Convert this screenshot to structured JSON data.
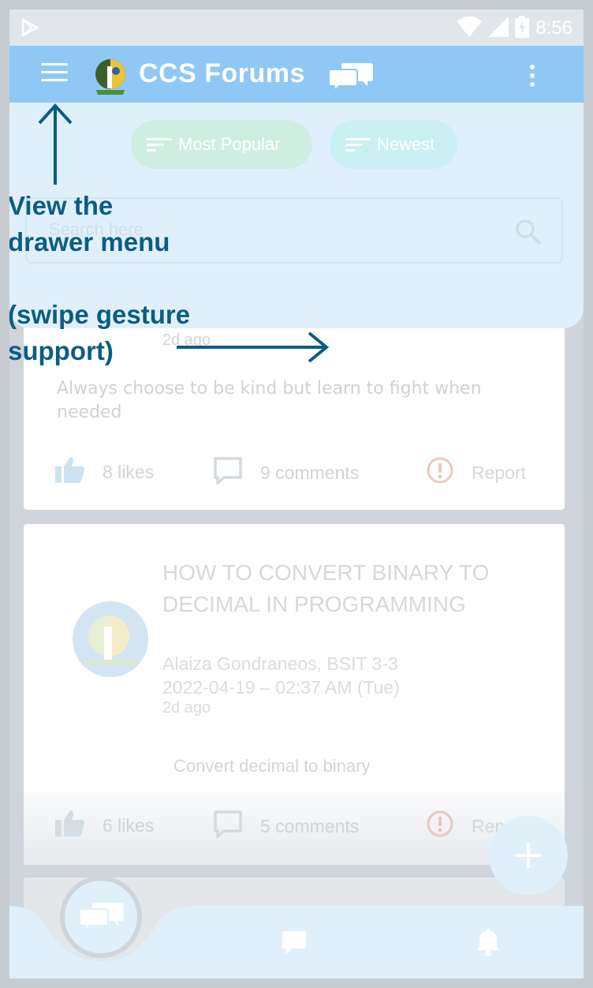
{
  "status_bar": {
    "time": "8:56"
  },
  "app_bar": {
    "title": "CCS Forums"
  },
  "filters": {
    "most_popular": "Most Popular",
    "newest": "Newest"
  },
  "search": {
    "placeholder": "Search here"
  },
  "annotations": {
    "drawer_line1": "View the",
    "drawer_line2": "drawer menu",
    "swipe_line1": "(swipe gesture",
    "swipe_line2": "support)"
  },
  "posts": [
    {
      "ago": "2d ago",
      "body": "Always choose to be kind but learn to fight when needed",
      "likes": "8 likes",
      "comments": "9 comments",
      "report": "Report"
    },
    {
      "title": "HOW TO CONVERT BINARY TO DECIMAL IN PROGRAMMING",
      "author": "Alaiza Gondraneos, BSIT 3-3",
      "date": "2022-04-19 – 02:37 AM (Tue)",
      "ago": "2d ago",
      "body": "Convert decimal to binary",
      "likes": "6 likes",
      "comments": "5 comments",
      "report": "Rep"
    }
  ],
  "colors": {
    "app_bar": "#8fc8f4",
    "overlay": "#e0f0fb",
    "annotation": "#0b5d82"
  },
  "icons": [
    "play-store-icon",
    "wifi-icon",
    "signal-icon",
    "battery-icon",
    "menu-icon",
    "ccs-logo-icon",
    "chat-bubbles-icon",
    "more-vert-icon",
    "filter-icon",
    "search-icon",
    "thumb-up-icon",
    "comment-icon",
    "report-icon",
    "plus-icon",
    "chat-icon",
    "bell-icon"
  ]
}
